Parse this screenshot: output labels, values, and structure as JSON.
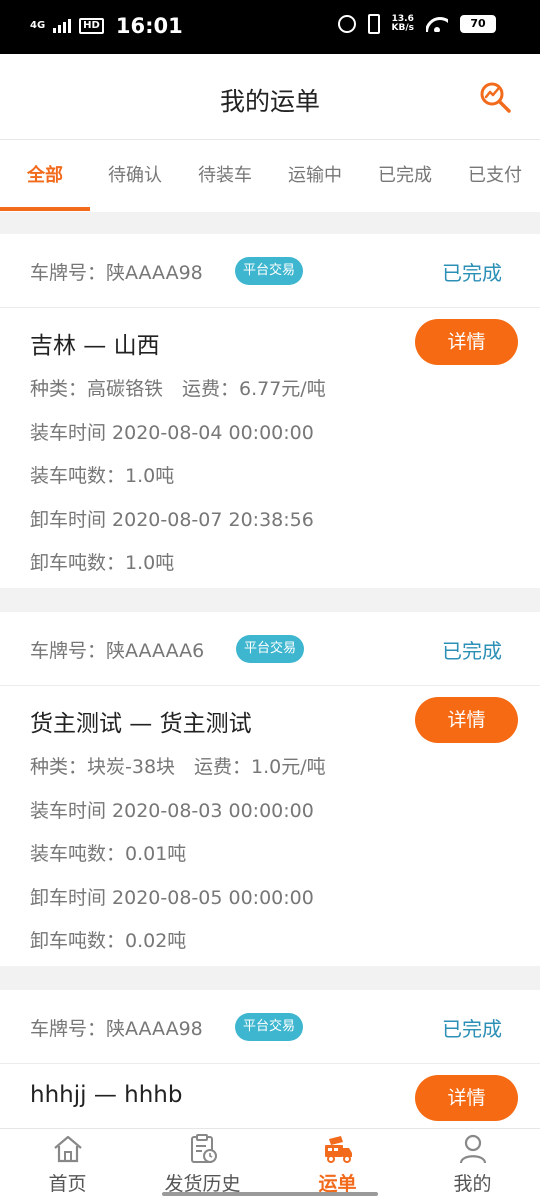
{
  "status_bar": {
    "network": "4G",
    "hd": "HD",
    "time": "16:01",
    "speed_value": "13.6",
    "speed_unit": "KB/s",
    "battery": "70"
  },
  "header": {
    "title": "我的运单",
    "search_icon": "search-chart-icon"
  },
  "tabs": [
    {
      "label": "全部",
      "active": true
    },
    {
      "label": "待确认",
      "active": false
    },
    {
      "label": "待装车",
      "active": false
    },
    {
      "label": "运输中",
      "active": false
    },
    {
      "label": "已完成",
      "active": false
    },
    {
      "label": "已支付",
      "active": false
    }
  ],
  "orders": [
    {
      "plate": "车牌号：陕AAAA98",
      "badge": "平台交易",
      "status": "已完成",
      "route": "吉林 — 山西",
      "detail_label": "详情",
      "category": "种类：高碳铬铁　运费：6.77元/吨",
      "load_time": "装车时间 2020-08-04 00:00:00",
      "load_tonnage": "装车吨数：1.0吨",
      "unload_time": "卸车时间 2020-08-07 20:38:56",
      "unload_tonnage": "卸车吨数：1.0吨"
    },
    {
      "plate": "车牌号：陕AAAAA6",
      "badge": "平台交易",
      "status": "已完成",
      "route": "货主测试 — 货主测试",
      "detail_label": "详情",
      "category": "种类：块炭-38块　运费：1.0元/吨",
      "load_time": "装车时间 2020-08-03 00:00:00",
      "load_tonnage": "装车吨数：0.01吨",
      "unload_time": "卸车时间 2020-08-05 00:00:00",
      "unload_tonnage": "卸车吨数：0.02吨"
    },
    {
      "plate": "车牌号：陕AAAA98",
      "badge": "平台交易",
      "status": "已完成",
      "route": "hhhjj — hhhb",
      "detail_label": "详情"
    }
  ],
  "bottom_nav": [
    {
      "label": "首页",
      "icon": "home-icon",
      "active": false
    },
    {
      "label": "发货历史",
      "icon": "history-clipboard-icon",
      "active": false
    },
    {
      "label": "运单",
      "icon": "truck-icon",
      "active": true
    },
    {
      "label": "我的",
      "icon": "user-icon",
      "active": false
    }
  ],
  "colors": {
    "accent": "#f26b1d",
    "detail_button": "#f56a12",
    "badge": "#3fb6cf",
    "status_text": "#2c8fb5"
  }
}
